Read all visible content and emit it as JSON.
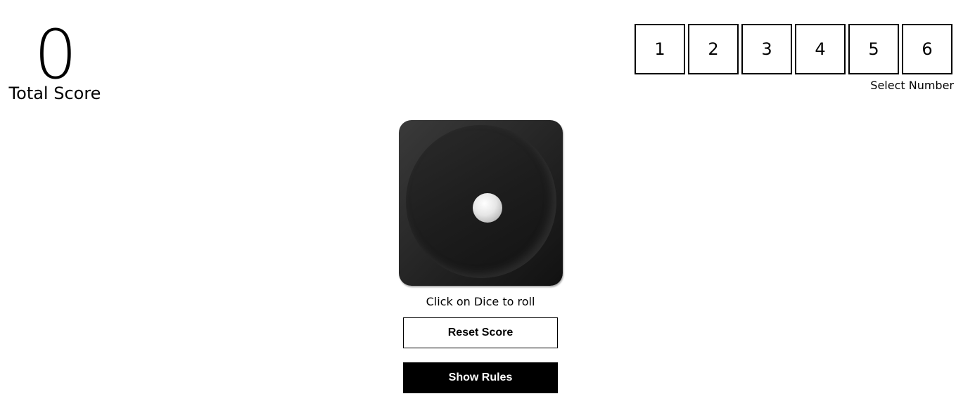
{
  "score": {
    "value": "0",
    "label": "Total Score"
  },
  "number_selector": {
    "numbers": [
      "1",
      "2",
      "3",
      "4",
      "5",
      "6"
    ],
    "label": "Select Number"
  },
  "dice": {
    "current_face": 1,
    "hint": "Click on Dice to roll"
  },
  "buttons": {
    "reset_label": "Reset Score",
    "rules_label": "Show Rules"
  },
  "colors": {
    "primary": "#000000",
    "background": "#ffffff"
  }
}
